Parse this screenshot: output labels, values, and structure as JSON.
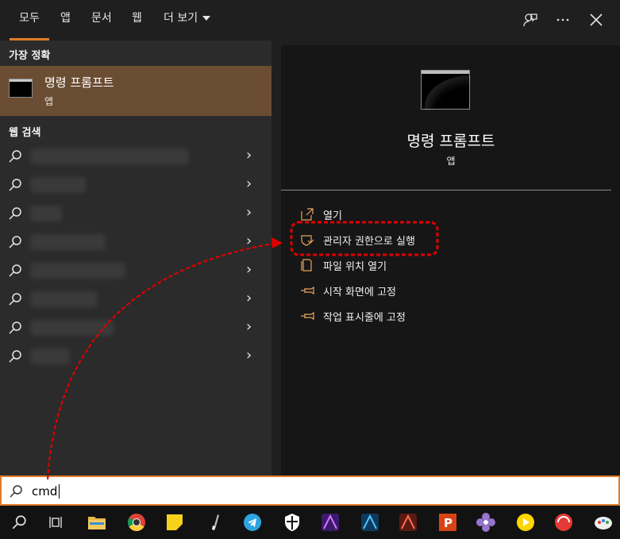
{
  "tabs": [
    {
      "label": "모두",
      "active": true
    },
    {
      "label": "앱"
    },
    {
      "label": "문서"
    },
    {
      "label": "웹"
    },
    {
      "label": "더 보기"
    }
  ],
  "top_icons": [
    "feedback-icon",
    "more-icon",
    "close-icon"
  ],
  "left": {
    "best_match_heading": "가장 정확",
    "best_match": {
      "name": "명령 프롬프트",
      "type": "앱"
    },
    "web_heading": "웹 검색",
    "web_row_count": 8
  },
  "right": {
    "app_name": "명령 프롬프트",
    "app_type": "앱",
    "actions": [
      {
        "label": "열기",
        "icon": "open-icon"
      },
      {
        "label": "관리자 권한으로 실행",
        "icon": "shield-icon",
        "highlighted": true
      },
      {
        "label": "파일 위치 열기",
        "icon": "file-icon"
      },
      {
        "label": "시작 화면에 고정",
        "icon": "pin-icon"
      },
      {
        "label": "작업 표시줄에 고정",
        "icon": "pin-icon"
      }
    ]
  },
  "search": {
    "value": "cmd"
  },
  "taskbar": [
    "search-icon",
    "task-view-icon",
    "file-explorer-icon",
    "chrome-icon",
    "sticky-notes-icon",
    "brush-icon",
    "telegram-icon",
    "security-icon",
    "affinity-photo-icon",
    "affinity-designer-icon",
    "affinity-publisher-icon",
    "p-app-icon",
    "flower-app-icon",
    "play-icon",
    "red-app-icon",
    "paint-icon"
  ],
  "colors": {
    "accent": "#e07b28",
    "best_match_bg": "#6b4d33",
    "annotation": "#e00000"
  }
}
